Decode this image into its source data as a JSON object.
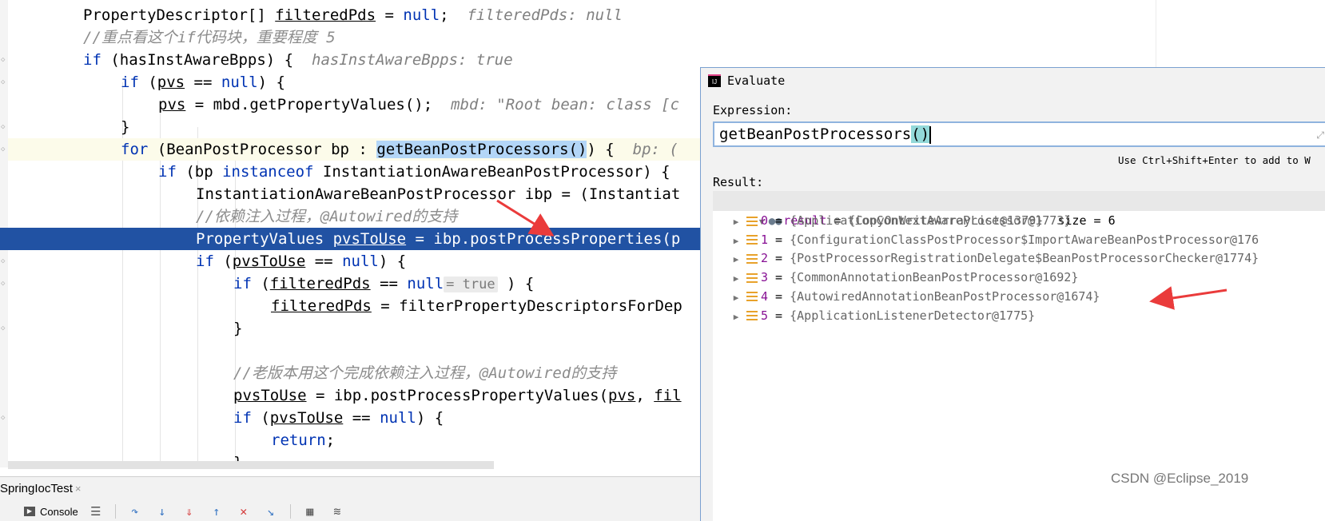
{
  "editor": {
    "lines": [
      {
        "indent": 0,
        "segs": [
          {
            "t": "PropertyDescriptor[] "
          },
          {
            "t": "filteredPds",
            "c": "ul"
          },
          {
            "t": " = "
          },
          {
            "t": "null",
            "c": "kw"
          },
          {
            "t": ";  "
          },
          {
            "t": "filteredPds: null",
            "c": "inl"
          }
        ]
      },
      {
        "indent": 0,
        "segs": [
          {
            "t": "//重点看这个if代码块，重要程度 5",
            "c": "cm"
          }
        ]
      },
      {
        "indent": 0,
        "segs": [
          {
            "t": "if",
            "c": "kw"
          },
          {
            "t": " (hasInstAwareBpps) {  "
          },
          {
            "t": "hasInstAwareBpps: true",
            "c": "inl"
          }
        ]
      },
      {
        "indent": 1,
        "segs": [
          {
            "t": "if",
            "c": "kw"
          },
          {
            "t": " ("
          },
          {
            "t": "pvs",
            "c": "ul"
          },
          {
            "t": " == "
          },
          {
            "t": "null",
            "c": "kw"
          },
          {
            "t": ") {"
          }
        ]
      },
      {
        "indent": 2,
        "segs": [
          {
            "t": "pvs",
            "c": "ul"
          },
          {
            "t": " = mbd.getPropertyValues();  "
          },
          {
            "t": "mbd: \"Root bean: class [c",
            "c": "inl"
          }
        ]
      },
      {
        "indent": 1,
        "segs": [
          {
            "t": "}"
          }
        ]
      },
      {
        "indent": 1,
        "cls": "cur",
        "segs": [
          {
            "t": "for",
            "c": "kw"
          },
          {
            "t": " (BeanPostProcessor bp : "
          },
          {
            "t": "getBeanPostProcessors()",
            "c": "hl"
          },
          {
            "t": ") {  "
          },
          {
            "t": "bp: (",
            "c": "inl"
          }
        ]
      },
      {
        "indent": 2,
        "segs": [
          {
            "t": "if",
            "c": "kw"
          },
          {
            "t": " (bp "
          },
          {
            "t": "instanceof",
            "c": "kw"
          },
          {
            "t": " InstantiationAwareBeanPostProcessor) {"
          }
        ]
      },
      {
        "indent": 3,
        "segs": [
          {
            "t": "InstantiationAwareBeanPostProcessor ibp = (Instantiat"
          }
        ]
      },
      {
        "indent": 3,
        "segs": [
          {
            "t": "//依赖注入过程，@Autowired的支持",
            "c": "cm"
          }
        ]
      },
      {
        "indent": 3,
        "cls": "sel",
        "segs": [
          {
            "t": "PropertyValues "
          },
          {
            "t": "pvsToUse",
            "c": "ul"
          },
          {
            "t": " = ibp.postProcessProperties(p"
          }
        ]
      },
      {
        "indent": 3,
        "segs": [
          {
            "t": "if",
            "c": "kw"
          },
          {
            "t": " ("
          },
          {
            "t": "pvsToUse",
            "c": "ul"
          },
          {
            "t": " == "
          },
          {
            "t": "null",
            "c": "kw"
          },
          {
            "t": ") {"
          }
        ]
      },
      {
        "indent": 4,
        "segs": [
          {
            "t": "if",
            "c": "kw"
          },
          {
            "t": " ("
          },
          {
            "t": "filteredPds",
            "c": "ul"
          },
          {
            "t": " == "
          },
          {
            "t": "null",
            "c": "kw"
          },
          {
            "t": "= true",
            "c": "hint"
          },
          {
            "t": " ) {"
          }
        ]
      },
      {
        "indent": 5,
        "segs": [
          {
            "t": "filteredPds",
            "c": "ul"
          },
          {
            "t": " = filterPropertyDescriptorsForDep"
          }
        ]
      },
      {
        "indent": 4,
        "segs": [
          {
            "t": "}"
          }
        ]
      },
      {
        "indent": 4,
        "segs": [
          {
            "t": ""
          }
        ]
      },
      {
        "indent": 4,
        "segs": [
          {
            "t": "//老版本用这个完成依赖注入过程，@Autowired的支持",
            "c": "cm"
          }
        ]
      },
      {
        "indent": 4,
        "segs": [
          {
            "t": "pvsToUse",
            "c": "ul"
          },
          {
            "t": " = ibp.postProcessPropertyValues("
          },
          {
            "t": "pvs",
            "c": "ul"
          },
          {
            "t": ", "
          },
          {
            "t": "fil",
            "c": "ul"
          }
        ]
      },
      {
        "indent": 4,
        "segs": [
          {
            "t": "if",
            "c": "kw"
          },
          {
            "t": " ("
          },
          {
            "t": "pvsToUse",
            "c": "ul"
          },
          {
            "t": " == "
          },
          {
            "t": "null",
            "c": "kw"
          },
          {
            "t": ") {"
          }
        ]
      },
      {
        "indent": 5,
        "segs": [
          {
            "t": "return",
            "c": "kw"
          },
          {
            "t": ";"
          }
        ]
      },
      {
        "indent": 4,
        "segs": [
          {
            "t": "}"
          }
        ]
      }
    ]
  },
  "run_panel": {
    "tab_label": "SpringIocTest",
    "tab_close": "×",
    "console_label": "Console",
    "tools": [
      "menu-icon",
      "step-over-icon",
      "step-into-icon",
      "force-step-into-icon",
      "step-out-icon",
      "drop-frame-icon",
      "run-to-cursor-icon",
      "evaluate-icon",
      "trace-icon"
    ]
  },
  "evaluate": {
    "title": "Evaluate",
    "app_icon_text": "IJ",
    "expression_label": "Expression:",
    "expression_method": "getBeanPostProcessors",
    "expression_parens": "()",
    "expression_value": "getBeanPostProcessors()",
    "hint": "Use Ctrl+Shift+Enter to add to W",
    "result_label": "Result:",
    "result": {
      "name": "result",
      "value": "{CopyOnWriteArrayList@1379}",
      "size_key": "size",
      "size_val": "6",
      "children": [
        {
          "idx": "0",
          "value": "{ApplicationContextAwareProcessor@1773}"
        },
        {
          "idx": "1",
          "value": "{ConfigurationClassPostProcessor$ImportAwareBeanPostProcessor@176"
        },
        {
          "idx": "2",
          "value": "{PostProcessorRegistrationDelegate$BeanPostProcessorChecker@1774}"
        },
        {
          "idx": "3",
          "value": "{CommonAnnotationBeanPostProcessor@1692}"
        },
        {
          "idx": "4",
          "value": "{AutowiredAnnotationBeanPostProcessor@1674}"
        },
        {
          "idx": "5",
          "value": "{ApplicationListenerDetector@1775}"
        }
      ]
    }
  },
  "colors": {
    "annotation_arrow": "#ea3b3b",
    "selection": "#2152a3",
    "keyword": "#0033b3"
  },
  "watermark": "CSDN @Eclipse_2019"
}
